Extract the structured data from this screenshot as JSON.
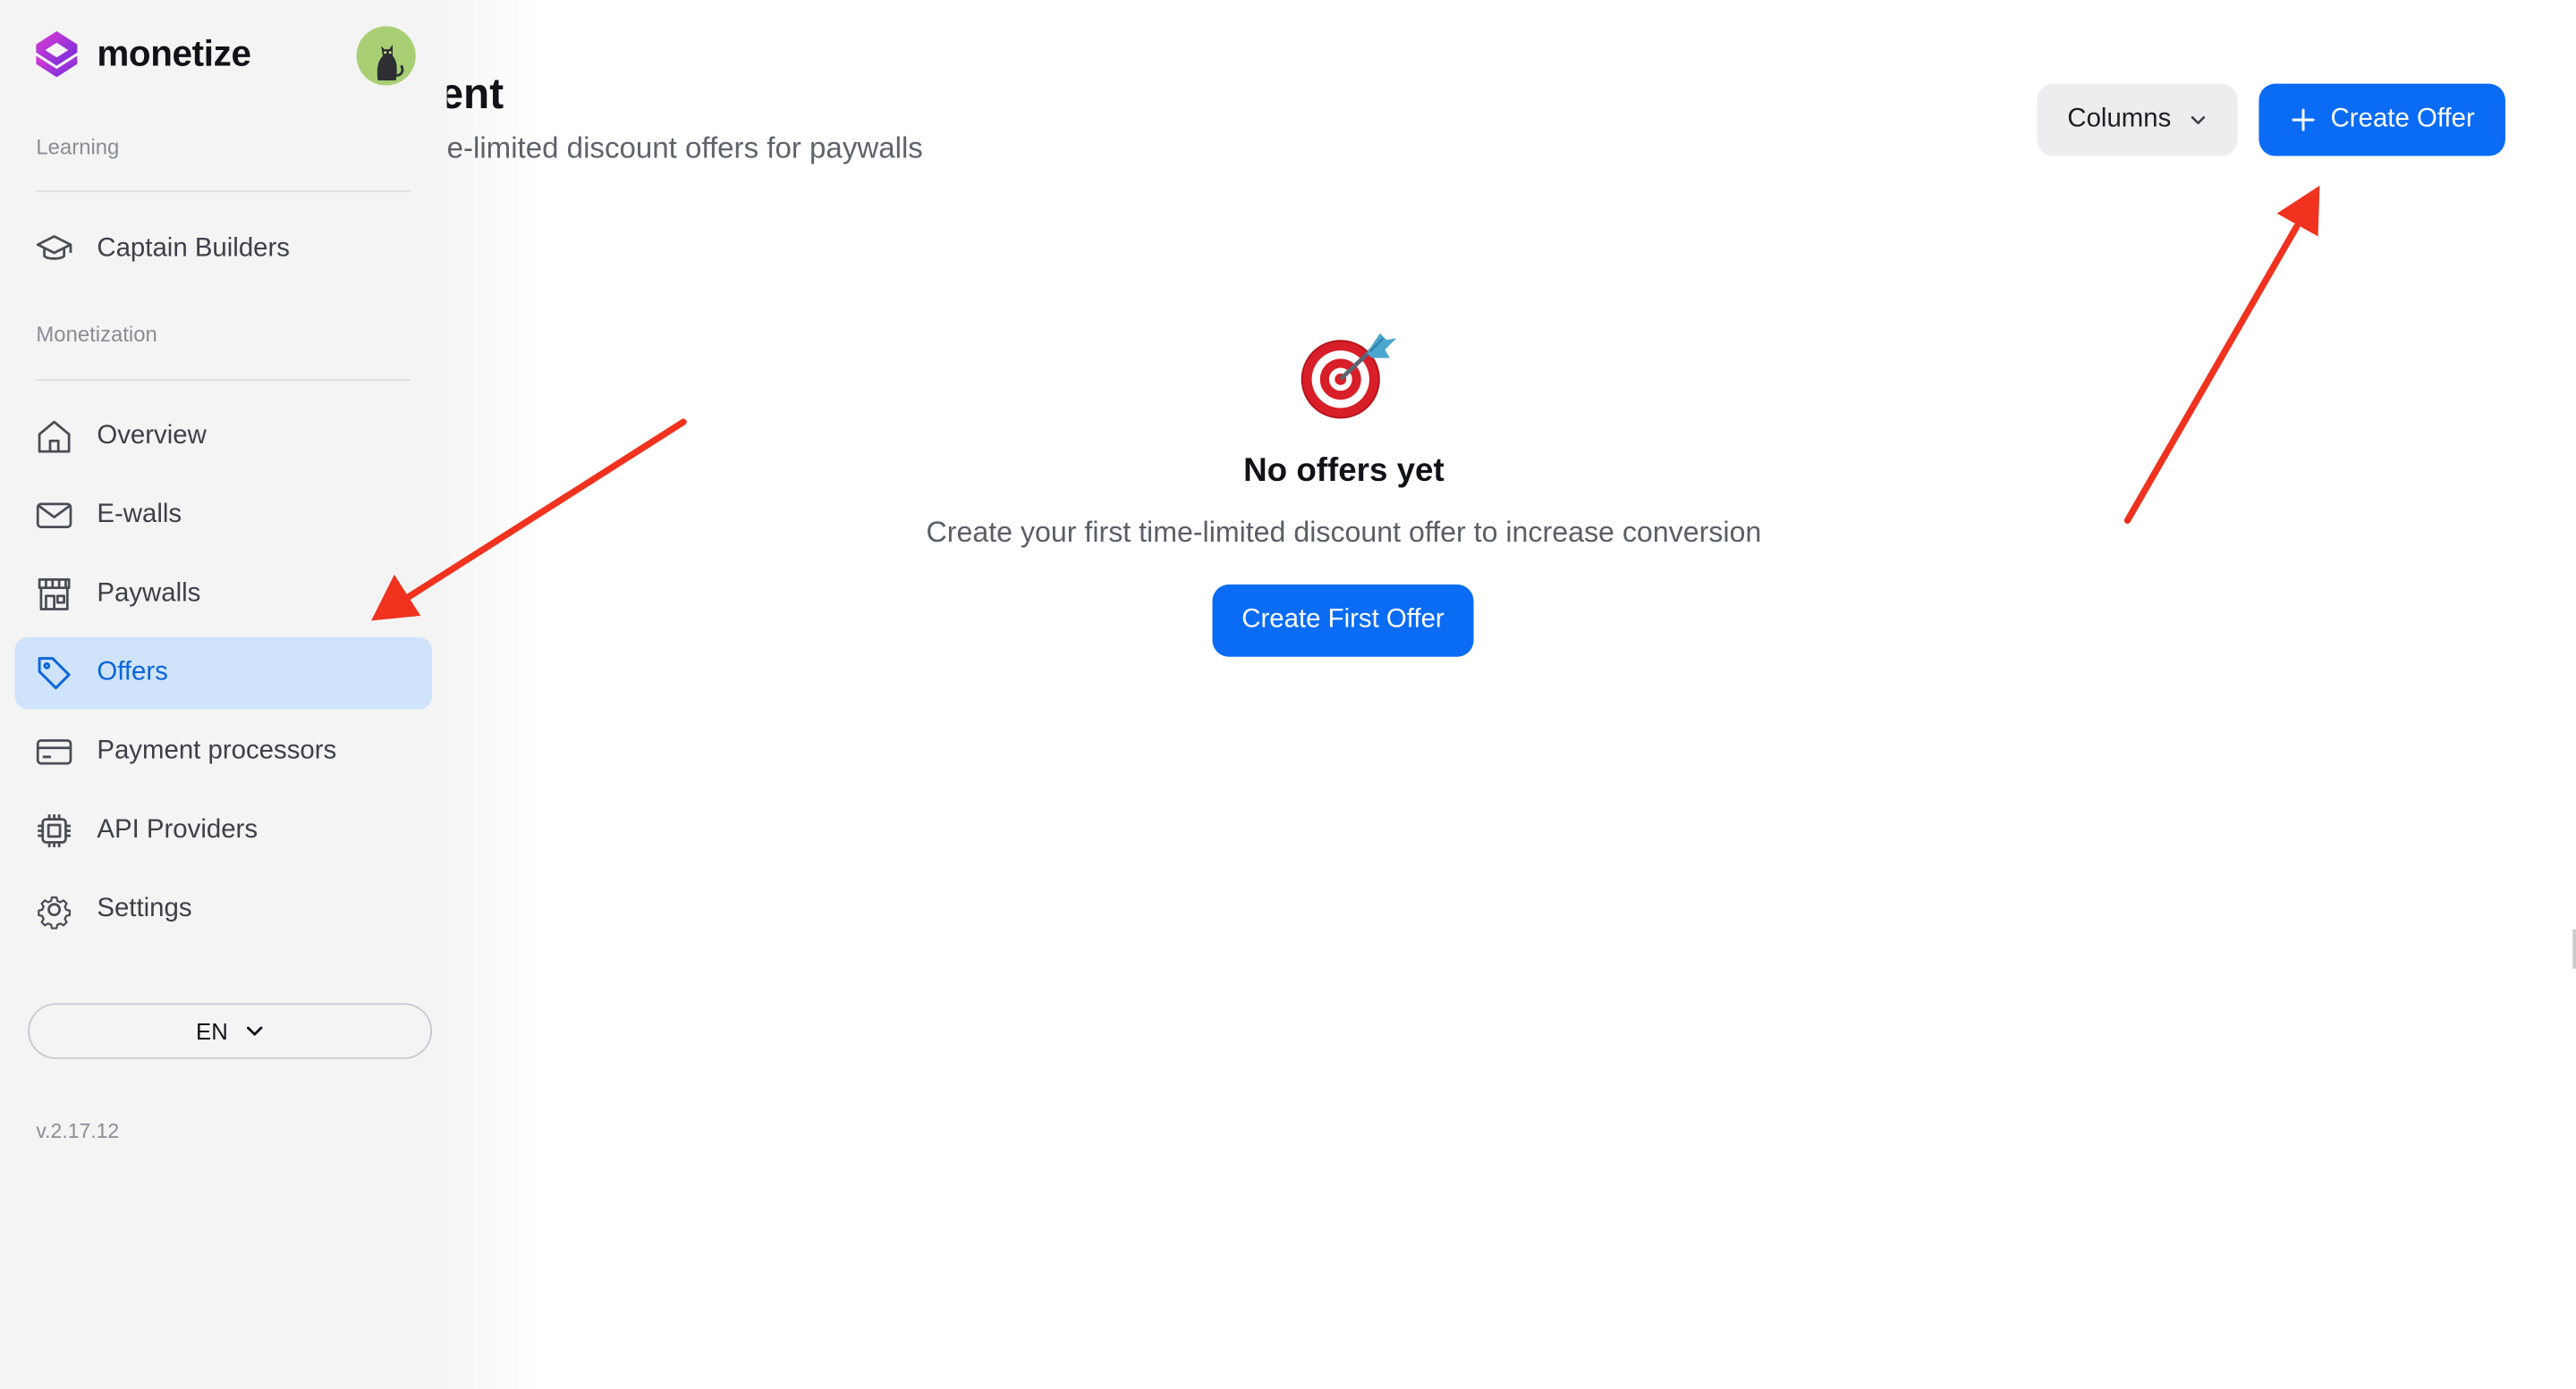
{
  "app": {
    "name": "monetize",
    "version": "v.2.17.12"
  },
  "sidebar": {
    "sections": [
      {
        "label": "Learning"
      },
      {
        "label": "Monetization"
      }
    ],
    "items": [
      {
        "label": "Captain Builders",
        "icon": "graduation-cap-icon"
      },
      {
        "label": "Overview",
        "icon": "home-icon"
      },
      {
        "label": "E-walls",
        "icon": "mail-icon"
      },
      {
        "label": "Paywalls",
        "icon": "store-icon"
      },
      {
        "label": "Offers",
        "icon": "tag-icon",
        "active": true
      },
      {
        "label": "Payment processors",
        "icon": "credit-card-icon"
      },
      {
        "label": "API Providers",
        "icon": "chip-icon"
      },
      {
        "label": "Settings",
        "icon": "gear-icon"
      }
    ],
    "language": "EN"
  },
  "header": {
    "title": "ement",
    "subtitle": "time-limited discount offers for paywalls",
    "columns_label": "Columns",
    "create_label": "Create Offer"
  },
  "empty_state": {
    "icon": "target-dart-icon",
    "title": "No offers yet",
    "text": "Create your first time-limited discount offer to increase conversion",
    "button_label": "Create First Offer"
  },
  "colors": {
    "accent": "#0a6cf5",
    "active_bg": "#cfe3fa",
    "active_text": "#0a66d9",
    "sidebar_bg": "#f4f4f5",
    "annotation_arrow": "#f0321e"
  }
}
